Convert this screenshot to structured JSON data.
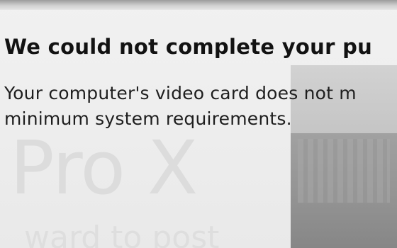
{
  "background": {
    "product_name": "Pro X",
    "tagline": "ward to post"
  },
  "dialog": {
    "title": "We could not complete your pu",
    "message_line1": "Your computer's video card does not m",
    "message_line2": "minimum system requirements."
  }
}
